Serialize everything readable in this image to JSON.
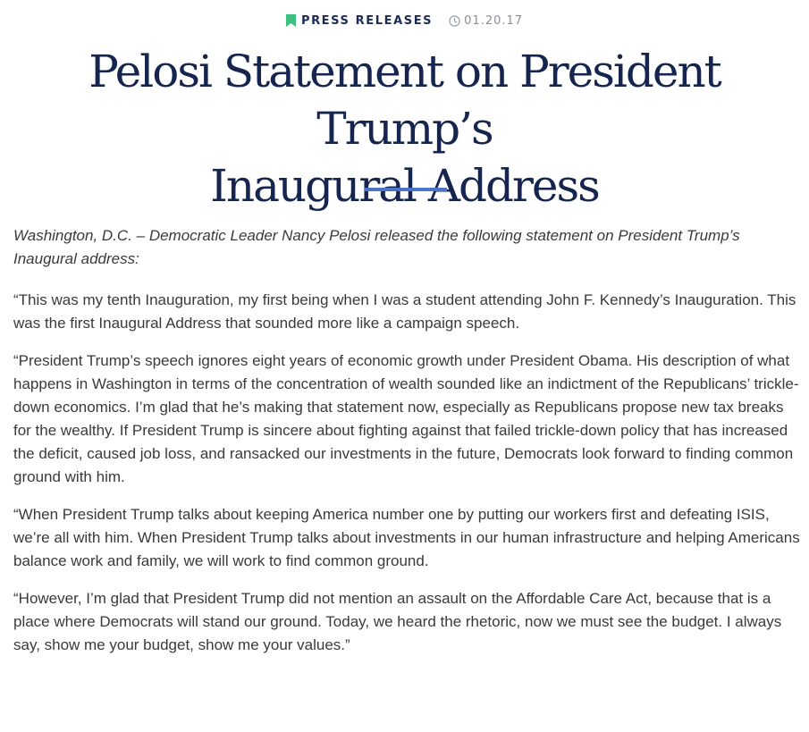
{
  "header": {
    "category_label": "PRESS RELEASES",
    "date": "01.20.17",
    "category_icon": "bookmark-icon",
    "date_icon": "clock-icon",
    "accent_color": "#3fbf7f"
  },
  "article": {
    "title_line1": "Pelosi Statement on President Trump’s",
    "title_line2": "Inaugural Address",
    "divider_color": "#4a74c9",
    "dateline": "Washington, D.C. – Democratic Leader Nancy Pelosi released the following statement on President Trump’s Inaugural address:",
    "paragraphs": [
      "“This was my tenth Inauguration, my first being when I was a student attending John F. Kennedy’s Inauguration.  This was the first Inaugural Address that sounded more like a campaign speech.",
      "“President Trump’s speech ignores eight years of economic growth under President Obama.  His description of what happens in Washington in terms of the concentration of wealth sounded like an indictment of the Republicans’ trickle-down economics.  I’m glad that he’s making that statement now, especially as Republicans propose new tax breaks for the wealthy.  If President Trump is sincere about fighting against that failed trickle-down policy that has increased the deficit, caused job loss, and ransacked our investments in the future, Democrats look forward to finding common ground with him.",
      "“When President Trump talks about keeping America number one by putting our workers first and defeating ISIS, we’re all with him.  When President Trump talks about investments in our human infrastructure and helping Americans balance work and family, we will work to find common ground.",
      "“However, I’m glad that President Trump did not mention an assault on the Affordable Care Act, because that is a place where Democrats will stand our ground.  Today, we heard the rhetoric, now we must see the budget.  I always say, show me your budget, show me your values.”"
    ]
  }
}
